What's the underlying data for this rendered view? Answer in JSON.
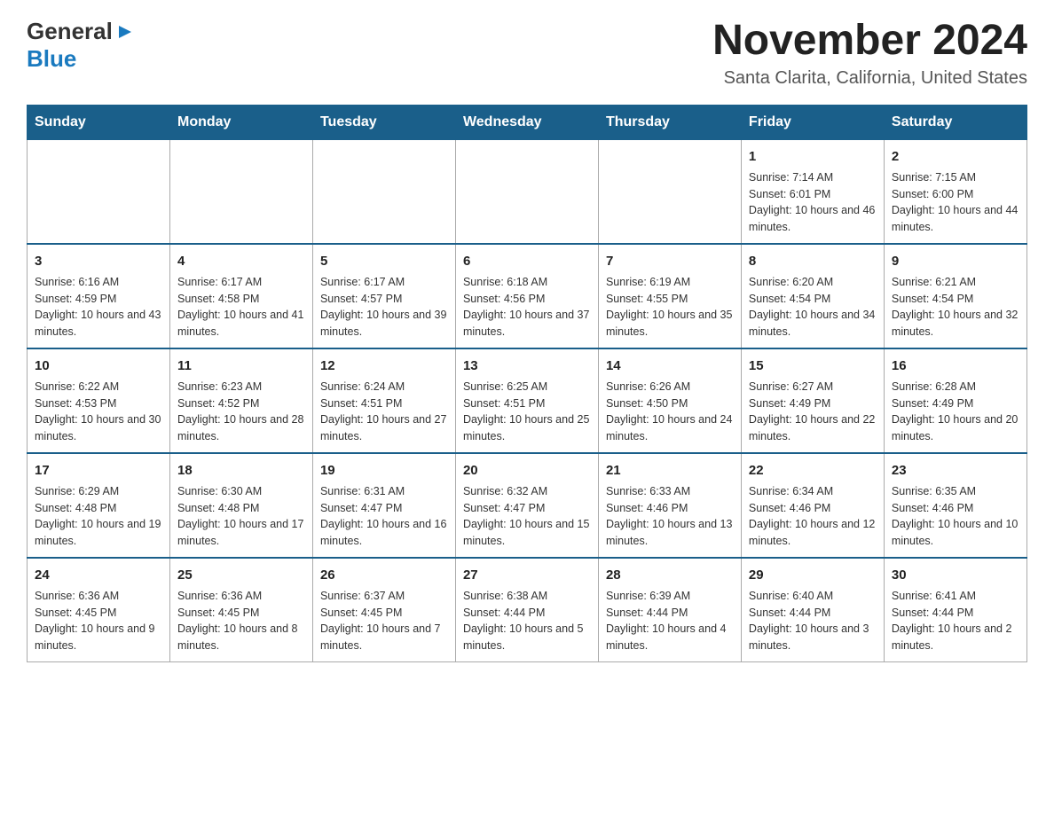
{
  "header": {
    "logo_general": "General",
    "logo_blue": "Blue",
    "title": "November 2024",
    "subtitle": "Santa Clarita, California, United States"
  },
  "calendar": {
    "days_of_week": [
      "Sunday",
      "Monday",
      "Tuesday",
      "Wednesday",
      "Thursday",
      "Friday",
      "Saturday"
    ],
    "weeks": [
      [
        {
          "day": "",
          "info": ""
        },
        {
          "day": "",
          "info": ""
        },
        {
          "day": "",
          "info": ""
        },
        {
          "day": "",
          "info": ""
        },
        {
          "day": "",
          "info": ""
        },
        {
          "day": "1",
          "info": "Sunrise: 7:14 AM\nSunset: 6:01 PM\nDaylight: 10 hours and 46 minutes."
        },
        {
          "day": "2",
          "info": "Sunrise: 7:15 AM\nSunset: 6:00 PM\nDaylight: 10 hours and 44 minutes."
        }
      ],
      [
        {
          "day": "3",
          "info": "Sunrise: 6:16 AM\nSunset: 4:59 PM\nDaylight: 10 hours and 43 minutes."
        },
        {
          "day": "4",
          "info": "Sunrise: 6:17 AM\nSunset: 4:58 PM\nDaylight: 10 hours and 41 minutes."
        },
        {
          "day": "5",
          "info": "Sunrise: 6:17 AM\nSunset: 4:57 PM\nDaylight: 10 hours and 39 minutes."
        },
        {
          "day": "6",
          "info": "Sunrise: 6:18 AM\nSunset: 4:56 PM\nDaylight: 10 hours and 37 minutes."
        },
        {
          "day": "7",
          "info": "Sunrise: 6:19 AM\nSunset: 4:55 PM\nDaylight: 10 hours and 35 minutes."
        },
        {
          "day": "8",
          "info": "Sunrise: 6:20 AM\nSunset: 4:54 PM\nDaylight: 10 hours and 34 minutes."
        },
        {
          "day": "9",
          "info": "Sunrise: 6:21 AM\nSunset: 4:54 PM\nDaylight: 10 hours and 32 minutes."
        }
      ],
      [
        {
          "day": "10",
          "info": "Sunrise: 6:22 AM\nSunset: 4:53 PM\nDaylight: 10 hours and 30 minutes."
        },
        {
          "day": "11",
          "info": "Sunrise: 6:23 AM\nSunset: 4:52 PM\nDaylight: 10 hours and 28 minutes."
        },
        {
          "day": "12",
          "info": "Sunrise: 6:24 AM\nSunset: 4:51 PM\nDaylight: 10 hours and 27 minutes."
        },
        {
          "day": "13",
          "info": "Sunrise: 6:25 AM\nSunset: 4:51 PM\nDaylight: 10 hours and 25 minutes."
        },
        {
          "day": "14",
          "info": "Sunrise: 6:26 AM\nSunset: 4:50 PM\nDaylight: 10 hours and 24 minutes."
        },
        {
          "day": "15",
          "info": "Sunrise: 6:27 AM\nSunset: 4:49 PM\nDaylight: 10 hours and 22 minutes."
        },
        {
          "day": "16",
          "info": "Sunrise: 6:28 AM\nSunset: 4:49 PM\nDaylight: 10 hours and 20 minutes."
        }
      ],
      [
        {
          "day": "17",
          "info": "Sunrise: 6:29 AM\nSunset: 4:48 PM\nDaylight: 10 hours and 19 minutes."
        },
        {
          "day": "18",
          "info": "Sunrise: 6:30 AM\nSunset: 4:48 PM\nDaylight: 10 hours and 17 minutes."
        },
        {
          "day": "19",
          "info": "Sunrise: 6:31 AM\nSunset: 4:47 PM\nDaylight: 10 hours and 16 minutes."
        },
        {
          "day": "20",
          "info": "Sunrise: 6:32 AM\nSunset: 4:47 PM\nDaylight: 10 hours and 15 minutes."
        },
        {
          "day": "21",
          "info": "Sunrise: 6:33 AM\nSunset: 4:46 PM\nDaylight: 10 hours and 13 minutes."
        },
        {
          "day": "22",
          "info": "Sunrise: 6:34 AM\nSunset: 4:46 PM\nDaylight: 10 hours and 12 minutes."
        },
        {
          "day": "23",
          "info": "Sunrise: 6:35 AM\nSunset: 4:46 PM\nDaylight: 10 hours and 10 minutes."
        }
      ],
      [
        {
          "day": "24",
          "info": "Sunrise: 6:36 AM\nSunset: 4:45 PM\nDaylight: 10 hours and 9 minutes."
        },
        {
          "day": "25",
          "info": "Sunrise: 6:36 AM\nSunset: 4:45 PM\nDaylight: 10 hours and 8 minutes."
        },
        {
          "day": "26",
          "info": "Sunrise: 6:37 AM\nSunset: 4:45 PM\nDaylight: 10 hours and 7 minutes."
        },
        {
          "day": "27",
          "info": "Sunrise: 6:38 AM\nSunset: 4:44 PM\nDaylight: 10 hours and 5 minutes."
        },
        {
          "day": "28",
          "info": "Sunrise: 6:39 AM\nSunset: 4:44 PM\nDaylight: 10 hours and 4 minutes."
        },
        {
          "day": "29",
          "info": "Sunrise: 6:40 AM\nSunset: 4:44 PM\nDaylight: 10 hours and 3 minutes."
        },
        {
          "day": "30",
          "info": "Sunrise: 6:41 AM\nSunset: 4:44 PM\nDaylight: 10 hours and 2 minutes."
        }
      ]
    ]
  }
}
